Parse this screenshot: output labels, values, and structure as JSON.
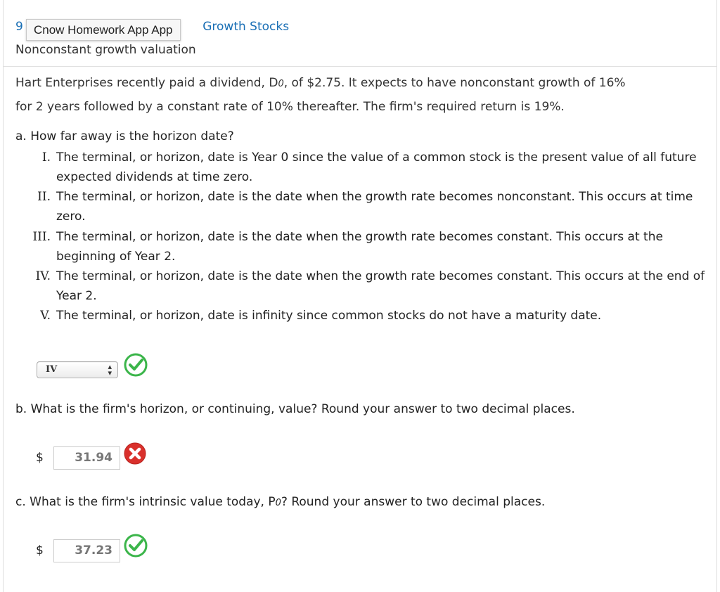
{
  "header": {
    "number": "9",
    "tooltip": "Cnow Homework App App",
    "section": "Growth Stocks",
    "subtitle": "Nonconstant growth valuation"
  },
  "intro": {
    "line1_a": "Hart Enterprises recently paid a dividend, D",
    "sub0": "0",
    "line1_b": ", of $2.75. It expects to have nonconstant growth of 16%",
    "line2": "for 2 years followed by a constant rate of 10% thereafter. The firm's required return is 19%."
  },
  "question_a": {
    "label": "a.  How far away is the horizon date?",
    "options": [
      {
        "roman": "I.",
        "text": "The terminal, or horizon, date is Year 0 since the value of a common stock is the present value of all future expected dividends at time zero."
      },
      {
        "roman": "II.",
        "text": "The terminal, or horizon, date is the date when the growth rate becomes nonconstant. This occurs at time zero."
      },
      {
        "roman": "III.",
        "text": "The terminal, or horizon, date is the date when the growth rate becomes constant. This occurs at the beginning of Year 2."
      },
      {
        "roman": "IV.",
        "text": "The terminal, or horizon, date is the date when the growth rate becomes constant. This occurs at the end of Year 2."
      },
      {
        "roman": "V.",
        "text": "The terminal, or horizon, date is infinity since common stocks do not have a maturity date."
      }
    ],
    "selected": "IV",
    "status": "correct"
  },
  "question_b": {
    "label": "b.  What is the firm's horizon, or continuing, value? Round your answer to two decimal places.",
    "currency": "$",
    "answer": "31.94",
    "status": "incorrect"
  },
  "question_c": {
    "label_a": "c.  What is the firm's intrinsic value today, P",
    "sub0": "0",
    "label_b": "? Round your answer to two decimal places.",
    "currency": "$",
    "answer": "37.23",
    "status": "correct"
  },
  "colors": {
    "link": "#1a6fb5",
    "correct": "#3bb54a",
    "incorrect": "#d9302c"
  }
}
